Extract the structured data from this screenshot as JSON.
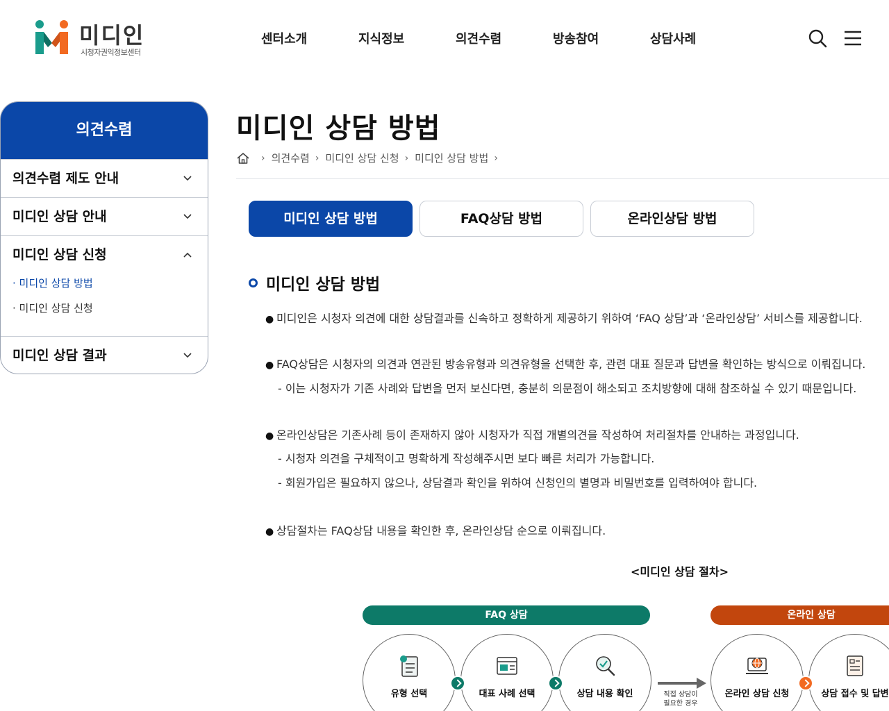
{
  "brand": {
    "name": "미디인",
    "subtitle": "시청자권익정보센터",
    "colors": {
      "primary": "#0b47a8",
      "logo_teal": "#1a9c8c",
      "logo_orange": "#f26a22",
      "faq_bar": "#0d7a68",
      "online_bar": "#c2460d"
    }
  },
  "gnb": [
    "센터소개",
    "지식정보",
    "의견수렴",
    "방송참여",
    "상담사례"
  ],
  "header_icons": {
    "search": "search-icon",
    "menu": "hamburger-menu-icon"
  },
  "sidebar": {
    "title": "의견수렴",
    "items": [
      {
        "label": "의견수렴 제도 안내",
        "state": "collapsed"
      },
      {
        "label": "미디인 상담 안내",
        "state": "collapsed"
      },
      {
        "label": "미디인 상담 신청",
        "state": "expanded",
        "children": [
          {
            "label": "· 미디인 상담 방법",
            "active": true
          },
          {
            "label": "· 미디인 상담 신청",
            "active": false
          }
        ]
      },
      {
        "label": "미디인 상담 결과",
        "state": "collapsed"
      }
    ]
  },
  "page": {
    "title": "미디인 상담 방법",
    "breadcrumb": [
      "의견수렴",
      "미디인 상담 신청",
      "미디인 상담 방법"
    ]
  },
  "tabs": [
    {
      "label": "미디인 상담 방법",
      "active": true
    },
    {
      "label": "FAQ상담 방법",
      "active": false
    },
    {
      "label": "온라인상담 방법",
      "active": false
    }
  ],
  "section": {
    "title": "미디인 상담 방법",
    "bullets": [
      {
        "text": "미디인은 시청자 의견에 대한 상담결과를 신속하고 정확하게 제공하기 위하여 ‘FAQ 상담’과 ‘온라인상담’ 서비스를 제공합니다."
      },
      {
        "text": "FAQ상담은 시청자의 의견과 연관된 방송유형과 의견유형을 선택한 후, 관련 대표 질문과 답변을 확인하는 방식으로 이뤄집니다.",
        "subs": [
          "- 이는 시청자가 기존 사례와 답변을 먼저 보신다면, 충분히 의문점이 해소되고 조치방향에 대해 참조하실 수 있기 때문입니다."
        ]
      },
      {
        "text": "온라인상담은 기존사례 등이 존재하지 않아 시청자가 직접 개별의견을 작성하여 처리절차를 안내하는 과정입니다.",
        "subs": [
          "- 시청자 의견을 구체적이고 명확하게 작성해주시면 보다 빠른 처리가 가능합니다.",
          "- 회원가입은 필요하지 않으나, 상담결과 확인을 위하여 신청인의 별명과 비밀번호를 입력하여야 합니다."
        ]
      },
      {
        "text": "상담절차는 FAQ상담 내용을 확인한 후, 온라인상담 순으로 이뤄집니다."
      }
    ]
  },
  "process": {
    "title": "<미디인 상담 절차>",
    "faq_label": "FAQ 상담",
    "online_label": "온라인 상담",
    "steps": [
      {
        "label": "유형 선택",
        "icon": "document-list-icon"
      },
      {
        "label": "대표 사례 선택",
        "icon": "browser-window-icon"
      },
      {
        "label": "상담 내용 확인",
        "icon": "magnifier-check-icon"
      },
      {
        "label": "온라인 상담 신청",
        "icon": "globe-laptop-icon"
      },
      {
        "label": "상담 접수 및 답변",
        "icon": "form-document-icon"
      }
    ],
    "arrow_note_1": "직접 상담이",
    "arrow_note_2": "필요한 경우"
  }
}
